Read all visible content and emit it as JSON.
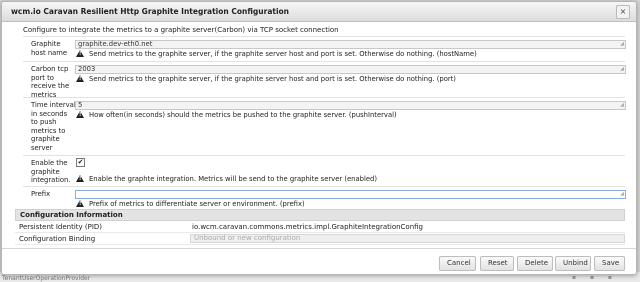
{
  "dialog": {
    "title": "wcm.io Caravan Resilient Http Graphite Integration Configuration",
    "close_label": "×",
    "subtitle": "Configure to integrate the metrics to a graphite server(Carbon) via TCP socket connection"
  },
  "fields": [
    {
      "label": "Graphite host name",
      "value": "graphite.dev-eth0.net",
      "hint": "Send metrics to the graphite server, if the graphite server host and port is set. Otherwise do nothing. (hostName)"
    },
    {
      "label": "Carbon tcp port to receive the metrics",
      "value": "2003",
      "hint": "Send metrics to the graphite server, if the graphite server host and port is set. Otherwise do nothing. (port)"
    },
    {
      "label": "Time interval in seconds to push metrics to graphite server",
      "value": "5",
      "hint": "How often(in seconds) should the metrics be pushed to the graphite server. (pushInterval)"
    },
    {
      "label": "Enable the graphite integration.",
      "checked_mark": "✔",
      "hint": "Enable the graphte integration. Metrics will be send to the graphite server (enabled)"
    },
    {
      "label": "Prefix",
      "value": "",
      "hint": "Prefix of metrics to differentiate server or environment. (prefix)"
    }
  ],
  "config_info": {
    "heading": "Configuration Information",
    "pid_label": "Persistent Identity (PID)",
    "pid_value": "io.wcm.caravan.commons.metrics.impl.GraphiteIntegrationConfig",
    "binding_label": "Configuration Binding",
    "binding_value": "Unbound or new configuration"
  },
  "buttons": {
    "cancel": "Cancel",
    "reset": "Reset",
    "delete": "Delete",
    "unbind": "Unbind",
    "save": "Save"
  },
  "background": {
    "partial_text": "TenantUserOperationProvider"
  },
  "icons": [
    "warning-icon",
    "close-icon",
    "checkbox-check-icon",
    "resize-grip-icon"
  ]
}
